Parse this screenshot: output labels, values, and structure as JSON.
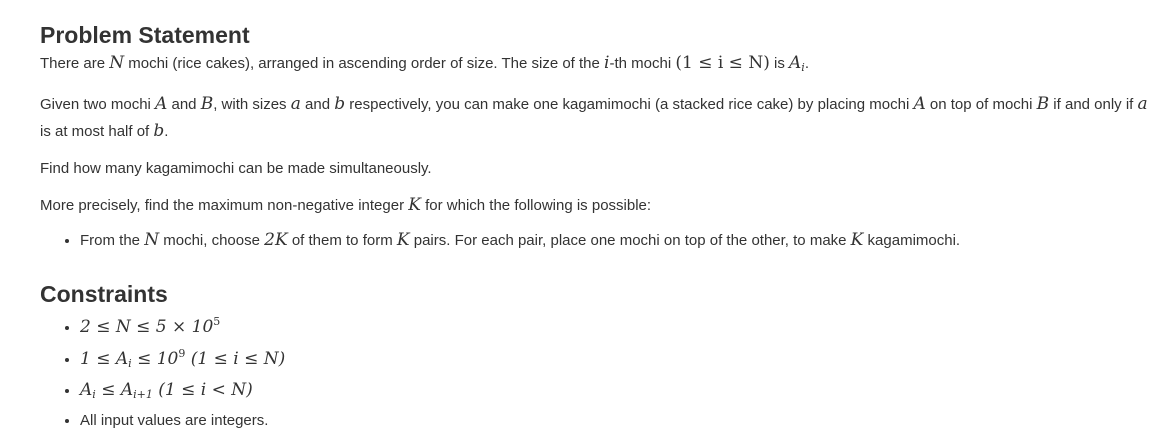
{
  "problem": {
    "heading": "Problem Statement",
    "p1": {
      "t1": "There are ",
      "N": "N",
      "t2": " mochi (rice cakes), arranged in ascending order of size. The size of the ",
      "i": "i",
      "t3": "-th mochi ",
      "range": "(1 ≤ i ≤ N)",
      "t4": " is ",
      "Ai": "A",
      "Ai_sub": "i",
      "t5": "."
    },
    "p2": {
      "t1": "Given two mochi ",
      "A": "A",
      "t2": " and ",
      "B": "B",
      "t3": ", with sizes ",
      "a": "a",
      "t4": " and ",
      "b": "b",
      "t5": " respectively, you can make one kagamimochi (a stacked rice cake) by placing mochi ",
      "A2": "A",
      "t6": " on top of mochi ",
      "B2": "B",
      "t7": " if and only if ",
      "a2": "a",
      "t8": " is at most half of ",
      "b2": "b",
      "t9": "."
    },
    "p3": "Find how many kagamimochi can be made simultaneously.",
    "p4": {
      "t1": "More precisely, find the maximum non-negative integer ",
      "K": "K",
      "t2": " for which the following is possible:"
    },
    "bullet": {
      "t1": "From the ",
      "N": "N",
      "t2": " mochi, choose ",
      "twoK": "2K",
      "t3": " of them to form ",
      "K": "K",
      "t4": " pairs. For each pair, place one mochi on top of the other, to make ",
      "K2": "K",
      "t5": " kagamimochi."
    }
  },
  "constraints": {
    "heading": "Constraints",
    "c1": {
      "main": "2 ≤ N ≤ 5 × 10",
      "exp": "5"
    },
    "c2": {
      "a": "1 ≤ A",
      "sub": "i",
      "b": " ≤ 10",
      "exp": "9",
      "c": " (1 ≤ i ≤ N)"
    },
    "c3": {
      "a": "A",
      "sub": "i",
      "b": " ≤ A",
      "sub2": "i+1",
      "c": " (1 ≤ i < N)"
    },
    "c4": "All input values are integers."
  }
}
